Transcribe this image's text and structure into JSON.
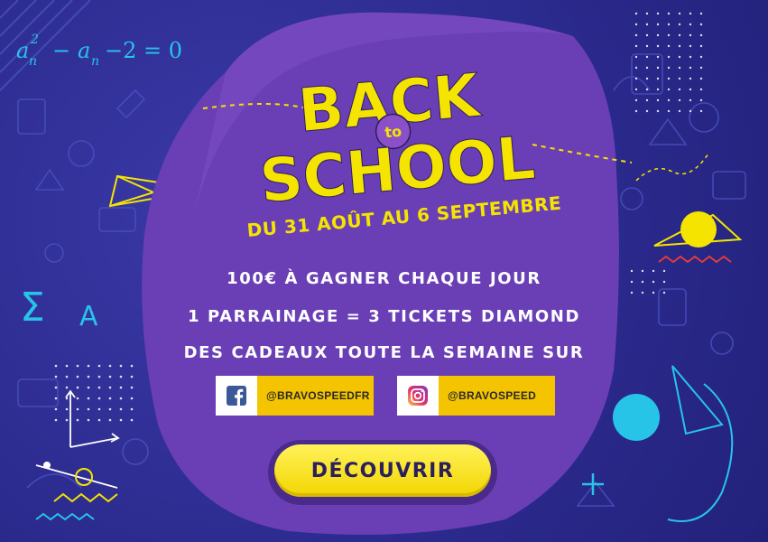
{
  "formula": {
    "a": "a",
    "n1": "n",
    "exp": "2",
    "minus": "−",
    "n2": "n",
    "rest": "−2 = 0"
  },
  "sigma": {
    "symbol": "Σ",
    "letter": "A"
  },
  "hero": {
    "back": "BACK",
    "to": "to",
    "school": "SCHOOL",
    "dates": "DU 31 AOÛT AU 6 SEPTEMBRE"
  },
  "lines": [
    "100€ À GAGNER CHAQUE JOUR",
    "1 PARRAINAGE = 3 TICKETS DIAMOND",
    "DES CADEAUX TOUTE LA SEMAINE SUR"
  ],
  "social": {
    "facebook": {
      "icon": "facebook-icon",
      "handle": "@BRAVOSPEEDFR"
    },
    "instagram": {
      "icon": "instagram-icon",
      "handle": "@BRAVOSPEED"
    }
  },
  "cta": {
    "label": "DÉCOUVRIR"
  },
  "colors": {
    "background": "#2c2b8f",
    "blob": "#6a3fb5",
    "yellow": "#f5e400",
    "cyan": "#27c4e8",
    "cta_text": "#2b1f5c"
  }
}
